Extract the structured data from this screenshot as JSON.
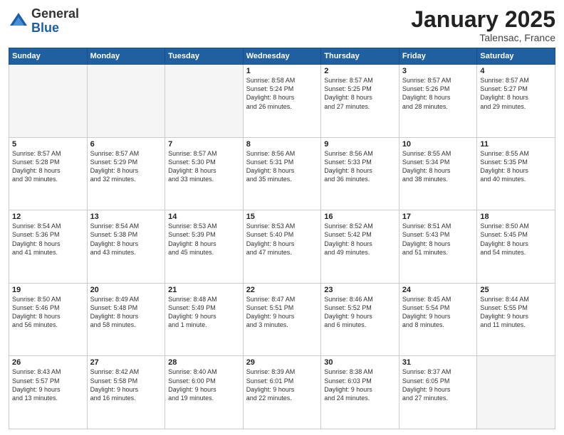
{
  "header": {
    "logo_general": "General",
    "logo_blue": "Blue",
    "month_title": "January 2025",
    "location": "Talensac, France"
  },
  "days_of_week": [
    "Sunday",
    "Monday",
    "Tuesday",
    "Wednesday",
    "Thursday",
    "Friday",
    "Saturday"
  ],
  "weeks": [
    [
      {
        "day": "",
        "info": ""
      },
      {
        "day": "",
        "info": ""
      },
      {
        "day": "",
        "info": ""
      },
      {
        "day": "1",
        "info": "Sunrise: 8:58 AM\nSunset: 5:24 PM\nDaylight: 8 hours\nand 26 minutes."
      },
      {
        "day": "2",
        "info": "Sunrise: 8:57 AM\nSunset: 5:25 PM\nDaylight: 8 hours\nand 27 minutes."
      },
      {
        "day": "3",
        "info": "Sunrise: 8:57 AM\nSunset: 5:26 PM\nDaylight: 8 hours\nand 28 minutes."
      },
      {
        "day": "4",
        "info": "Sunrise: 8:57 AM\nSunset: 5:27 PM\nDaylight: 8 hours\nand 29 minutes."
      }
    ],
    [
      {
        "day": "5",
        "info": "Sunrise: 8:57 AM\nSunset: 5:28 PM\nDaylight: 8 hours\nand 30 minutes."
      },
      {
        "day": "6",
        "info": "Sunrise: 8:57 AM\nSunset: 5:29 PM\nDaylight: 8 hours\nand 32 minutes."
      },
      {
        "day": "7",
        "info": "Sunrise: 8:57 AM\nSunset: 5:30 PM\nDaylight: 8 hours\nand 33 minutes."
      },
      {
        "day": "8",
        "info": "Sunrise: 8:56 AM\nSunset: 5:31 PM\nDaylight: 8 hours\nand 35 minutes."
      },
      {
        "day": "9",
        "info": "Sunrise: 8:56 AM\nSunset: 5:33 PM\nDaylight: 8 hours\nand 36 minutes."
      },
      {
        "day": "10",
        "info": "Sunrise: 8:55 AM\nSunset: 5:34 PM\nDaylight: 8 hours\nand 38 minutes."
      },
      {
        "day": "11",
        "info": "Sunrise: 8:55 AM\nSunset: 5:35 PM\nDaylight: 8 hours\nand 40 minutes."
      }
    ],
    [
      {
        "day": "12",
        "info": "Sunrise: 8:54 AM\nSunset: 5:36 PM\nDaylight: 8 hours\nand 41 minutes."
      },
      {
        "day": "13",
        "info": "Sunrise: 8:54 AM\nSunset: 5:38 PM\nDaylight: 8 hours\nand 43 minutes."
      },
      {
        "day": "14",
        "info": "Sunrise: 8:53 AM\nSunset: 5:39 PM\nDaylight: 8 hours\nand 45 minutes."
      },
      {
        "day": "15",
        "info": "Sunrise: 8:53 AM\nSunset: 5:40 PM\nDaylight: 8 hours\nand 47 minutes."
      },
      {
        "day": "16",
        "info": "Sunrise: 8:52 AM\nSunset: 5:42 PM\nDaylight: 8 hours\nand 49 minutes."
      },
      {
        "day": "17",
        "info": "Sunrise: 8:51 AM\nSunset: 5:43 PM\nDaylight: 8 hours\nand 51 minutes."
      },
      {
        "day": "18",
        "info": "Sunrise: 8:50 AM\nSunset: 5:45 PM\nDaylight: 8 hours\nand 54 minutes."
      }
    ],
    [
      {
        "day": "19",
        "info": "Sunrise: 8:50 AM\nSunset: 5:46 PM\nDaylight: 8 hours\nand 56 minutes."
      },
      {
        "day": "20",
        "info": "Sunrise: 8:49 AM\nSunset: 5:48 PM\nDaylight: 8 hours\nand 58 minutes."
      },
      {
        "day": "21",
        "info": "Sunrise: 8:48 AM\nSunset: 5:49 PM\nDaylight: 9 hours\nand 1 minute."
      },
      {
        "day": "22",
        "info": "Sunrise: 8:47 AM\nSunset: 5:51 PM\nDaylight: 9 hours\nand 3 minutes."
      },
      {
        "day": "23",
        "info": "Sunrise: 8:46 AM\nSunset: 5:52 PM\nDaylight: 9 hours\nand 6 minutes."
      },
      {
        "day": "24",
        "info": "Sunrise: 8:45 AM\nSunset: 5:54 PM\nDaylight: 9 hours\nand 8 minutes."
      },
      {
        "day": "25",
        "info": "Sunrise: 8:44 AM\nSunset: 5:55 PM\nDaylight: 9 hours\nand 11 minutes."
      }
    ],
    [
      {
        "day": "26",
        "info": "Sunrise: 8:43 AM\nSunset: 5:57 PM\nDaylight: 9 hours\nand 13 minutes."
      },
      {
        "day": "27",
        "info": "Sunrise: 8:42 AM\nSunset: 5:58 PM\nDaylight: 9 hours\nand 16 minutes."
      },
      {
        "day": "28",
        "info": "Sunrise: 8:40 AM\nSunset: 6:00 PM\nDaylight: 9 hours\nand 19 minutes."
      },
      {
        "day": "29",
        "info": "Sunrise: 8:39 AM\nSunset: 6:01 PM\nDaylight: 9 hours\nand 22 minutes."
      },
      {
        "day": "30",
        "info": "Sunrise: 8:38 AM\nSunset: 6:03 PM\nDaylight: 9 hours\nand 24 minutes."
      },
      {
        "day": "31",
        "info": "Sunrise: 8:37 AM\nSunset: 6:05 PM\nDaylight: 9 hours\nand 27 minutes."
      },
      {
        "day": "",
        "info": ""
      }
    ]
  ]
}
